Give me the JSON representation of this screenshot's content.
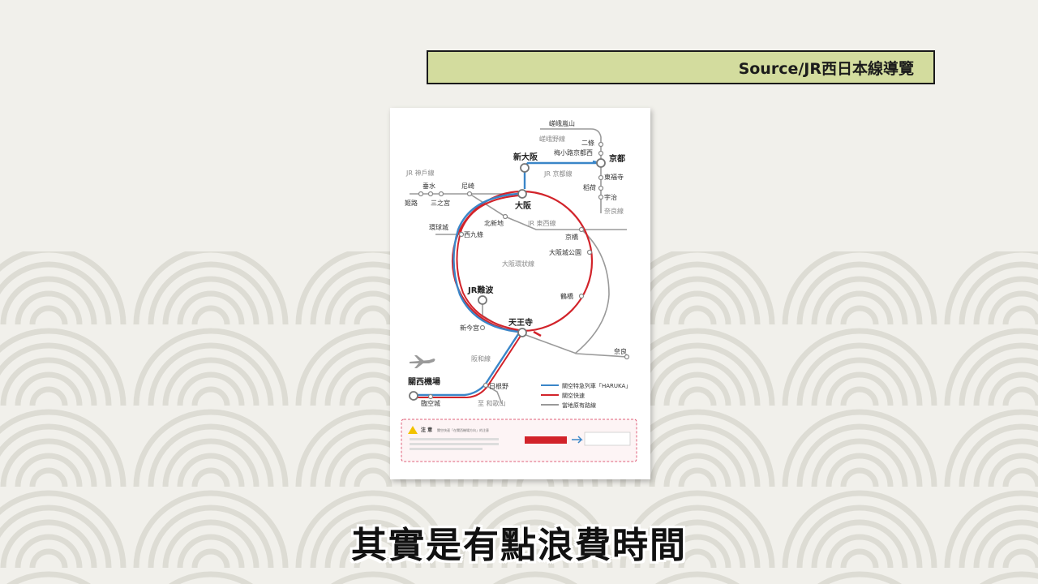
{
  "source_banner": "Source/JR西日本線導覽",
  "subtitle": "其實是有點浪費時間",
  "map": {
    "lines": {
      "jr_kobe": "JR 神戶線",
      "jr_kyoto": "JR 京都線",
      "jr_tozai": "JR 東西線",
      "osaka_loop": "大阪環狀線",
      "hanwa": "阪和線",
      "sagano": "嵯峨野線",
      "nara_line": "奈良線",
      "to_wakayama": "至 和歌山"
    },
    "stations": {
      "saga_arashiyama": "嵯峨嵐山",
      "nijo": "二條",
      "umekoji": "梅小路京都西",
      "kyoto": "京都",
      "shin_osaka": "新大阪",
      "tofukuji": "東福寺",
      "inari": "稻荷",
      "uji": "宇治",
      "tarumi": "垂水",
      "amagasaki": "尼崎",
      "himeji": "姬路",
      "sannomiya": "三之宮",
      "osaka": "大阪",
      "kitashinchi": "北新地",
      "kyobashi": "京橋",
      "universal_city": "環球城",
      "nishikujo": "西九條",
      "osakajokoen": "大阪城公園",
      "jr_namba": "JR難波",
      "tsuruhashi": "鶴橋",
      "shin_imamiya": "新今宮",
      "tennoji": "天王寺",
      "nara": "奈良",
      "kansai_airport": "關西機場",
      "hineno": "日根野",
      "rinku_town": "臨空城"
    },
    "legend": [
      {
        "label": "關空特急列車「HARUKA」",
        "color": "#3a86c8"
      },
      {
        "label": "關空快速",
        "color": "#d2232a"
      },
      {
        "label": "當地原有路線",
        "color": "#999999"
      }
    ],
    "notice": {
      "title": "注 意",
      "text": "關空快速「在關西機場方向」的注意"
    }
  },
  "colors": {
    "haruka": "#3a86c8",
    "kanku_rapid": "#d2232a",
    "local": "#999999",
    "banner_bg": "#d3dc9e",
    "notice_border": "#e0607a"
  }
}
